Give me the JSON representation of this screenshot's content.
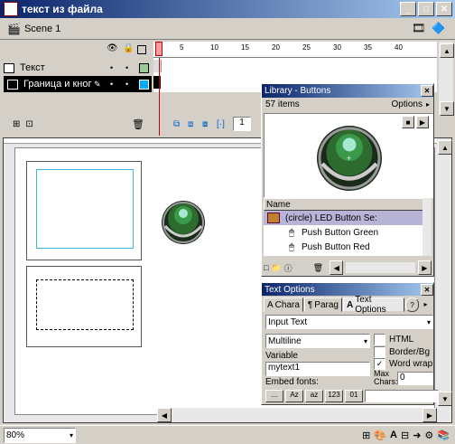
{
  "window": {
    "title": "текст из файла"
  },
  "scene": {
    "label": "Scene 1"
  },
  "timeline": {
    "ticks": [
      "5",
      "10",
      "15",
      "20",
      "25",
      "30",
      "35",
      "40"
    ],
    "layers": [
      {
        "name": "Текст"
      },
      {
        "name": "Граница и кног"
      }
    ],
    "frame_number": "1"
  },
  "library": {
    "title": "Library - Buttons",
    "count": "57 items",
    "options": "Options",
    "column_name": "Name",
    "items": [
      {
        "name": "(circle) LED Button Se:"
      },
      {
        "name": "Push Button Green"
      },
      {
        "name": "Push Button Red"
      }
    ]
  },
  "text_options": {
    "title": "Text Options",
    "tabs": [
      "Chara",
      "Parag",
      "Text Options"
    ],
    "text_type": "Input Text",
    "line_type": "Multiline",
    "html_label": "HTML",
    "border_label": "Border/Bg",
    "wordwrap_label": "Word wrap",
    "variable_label": "Variable",
    "variable_value": "mytext1",
    "maxchars_label": "Max\nChars:",
    "maxchars_value": "0",
    "embed_label": "Embed fonts:",
    "embed_buttons": [
      "...",
      "Az",
      "az",
      "123",
      "01"
    ]
  },
  "status": {
    "zoom": "80%"
  }
}
